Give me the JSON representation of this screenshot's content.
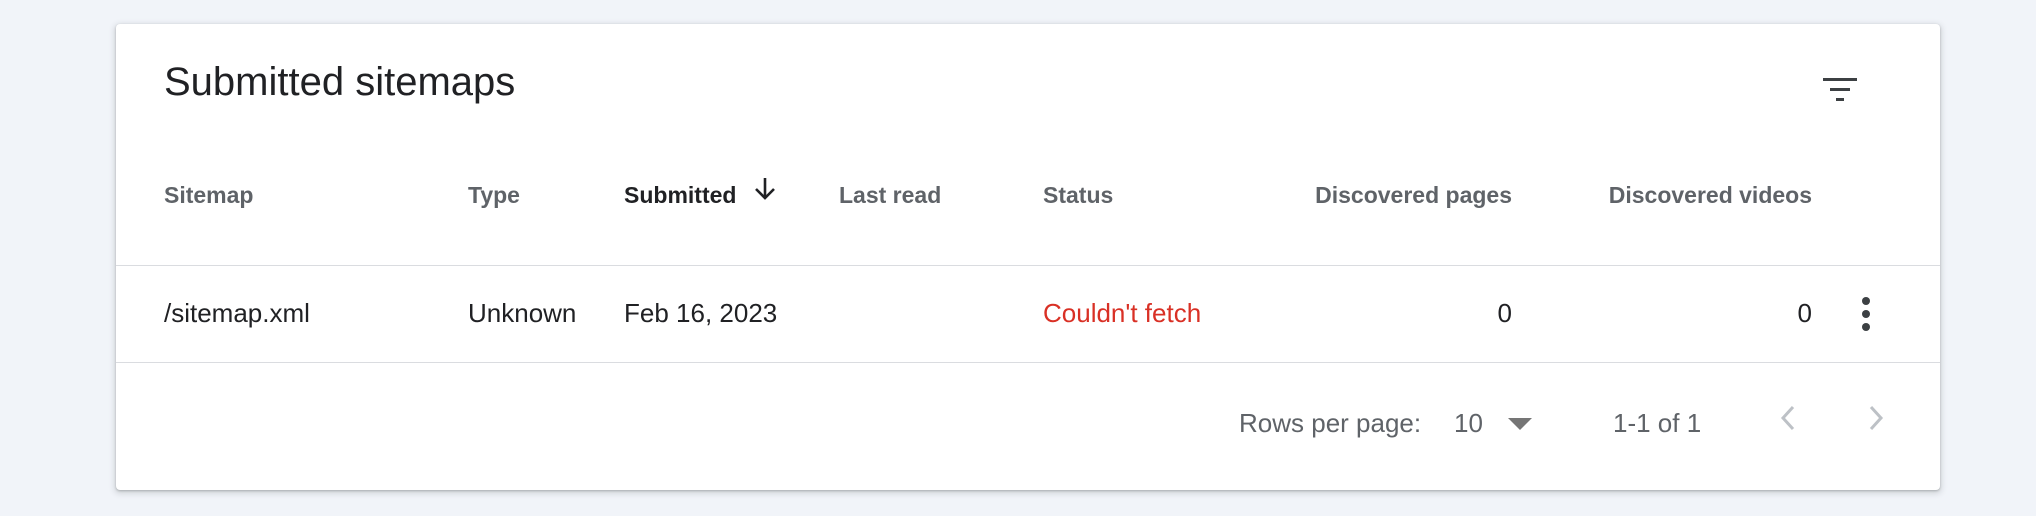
{
  "card": {
    "title": "Submitted sitemaps",
    "filter_icon": "filter-list-icon"
  },
  "table": {
    "columns": {
      "sitemap": "Sitemap",
      "type": "Type",
      "submitted": "Submitted",
      "last_read": "Last read",
      "status": "Status",
      "discovered_pages": "Discovered pages",
      "discovered_videos": "Discovered videos"
    },
    "sort": {
      "column": "Submitted",
      "direction": "descending",
      "icon": "arrow-down-icon"
    },
    "rows": [
      {
        "sitemap": "/sitemap.xml",
        "type": "Unknown",
        "submitted": "Feb 16, 2023",
        "last_read": "",
        "status": "Couldn't fetch",
        "discovered_pages": "0",
        "discovered_videos": "0",
        "menu_icon": "more-vert-icon"
      }
    ]
  },
  "pagination": {
    "rows_per_page_label": "Rows per page:",
    "rows_per_page_value": "10",
    "range": "1-1 of 1",
    "prev_icon": "chevron-left-icon",
    "next_icon": "chevron-right-icon"
  },
  "colors": {
    "background": "#f1f4f9",
    "card": "#ffffff",
    "text_primary": "#202124",
    "text_secondary": "#5f6368",
    "error": "#d93025",
    "divider": "#dadce0",
    "disabled_icon": "#bdc1c6"
  }
}
